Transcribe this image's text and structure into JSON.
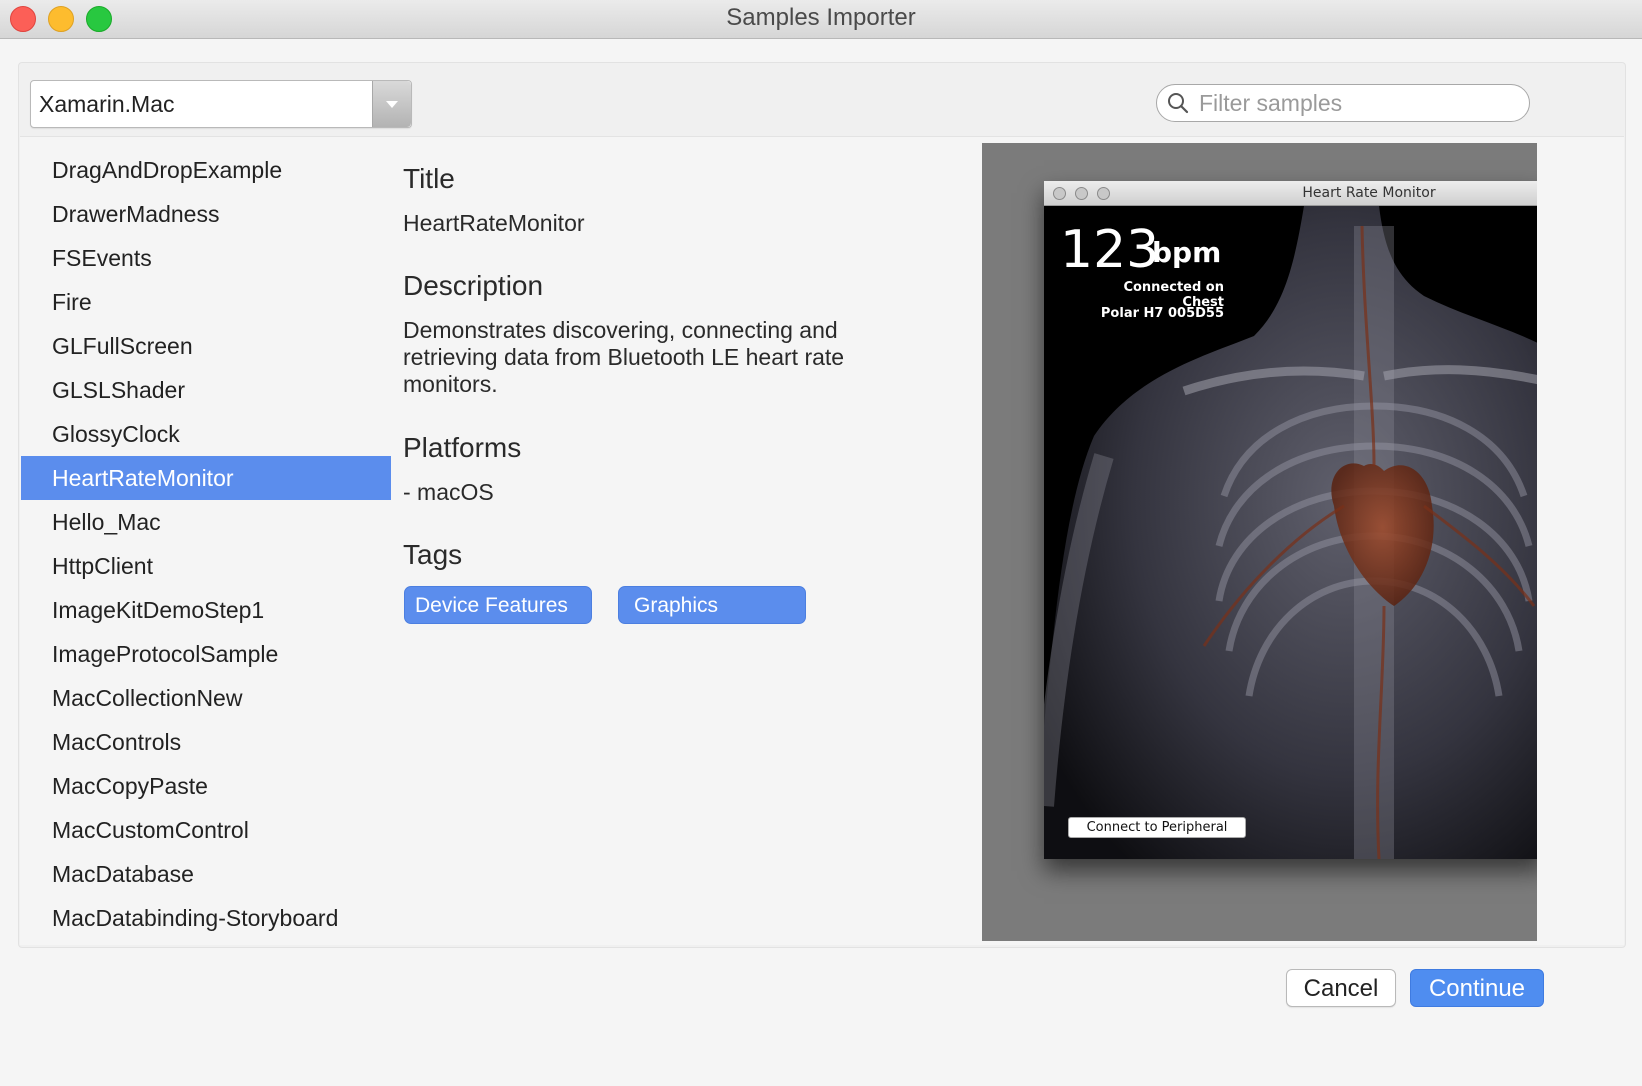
{
  "window": {
    "title": "Samples Importer"
  },
  "toolbar": {
    "platform_selected": "Xamarin.Mac",
    "search_placeholder": "Filter samples"
  },
  "samples": [
    "DragAndDropExample",
    "DrawerMadness",
    "FSEvents",
    "Fire",
    "GLFullScreen",
    "GLSLShader",
    "GlossyClock",
    "HeartRateMonitor",
    "Hello_Mac",
    "HttpClient",
    "ImageKitDemoStep1",
    "ImageProtocolSample",
    "MacCollectionNew",
    "MacControls",
    "MacCopyPaste",
    "MacCustomControl",
    "MacDatabase",
    "MacDatabinding-Storyboard"
  ],
  "selected_sample": "HeartRateMonitor",
  "details": {
    "title_heading": "Title",
    "title_value": "HeartRateMonitor",
    "description_heading": "Description",
    "description_value": "Demonstrates discovering, connecting and retrieving data from Bluetooth LE heart rate monitors.",
    "platforms_heading": "Platforms",
    "platforms_value": "- macOS",
    "tags_heading": "Tags",
    "tags": [
      "Device Features",
      "Graphics"
    ]
  },
  "preview": {
    "window_title": "Heart Rate Monitor",
    "bpm_value": "123",
    "bpm_unit": "bpm",
    "connection_status": "Connected on Chest",
    "device_name": "Polar H7 005D55",
    "connect_button": "Connect to Peripheral"
  },
  "footer": {
    "cancel_label": "Cancel",
    "continue_label": "Continue"
  },
  "colors": {
    "accent": "#5b8ded",
    "primary_button": "#4f8df0",
    "preview_background": "#7b7b7b"
  }
}
